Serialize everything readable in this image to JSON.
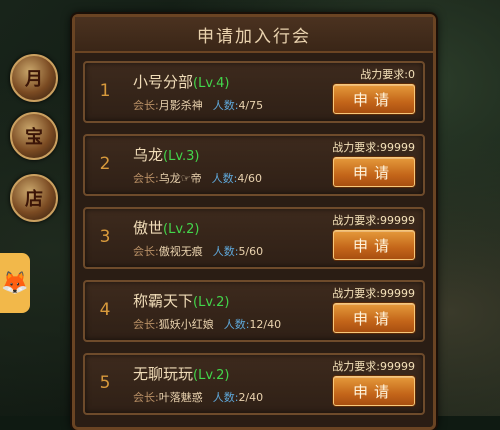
{
  "dialog": {
    "title": "申请加入行会",
    "leader_label": "会长:",
    "count_label": "人数:",
    "req_label": "战力要求:",
    "apply_label": "申请",
    "guilds": [
      {
        "rank": "1",
        "name": "小号分部",
        "level": "(Lv.4)",
        "leader": "月影杀神",
        "count": "4/75",
        "req": "0"
      },
      {
        "rank": "2",
        "name": "乌龙",
        "level": "(Lv.3)",
        "leader": "乌龙☞帝",
        "count": "4/60",
        "req": "99999"
      },
      {
        "rank": "3",
        "name": "傲世",
        "level": "(Lv.2)",
        "leader": "傲视无痕",
        "count": "5/60",
        "req": "99999"
      },
      {
        "rank": "4",
        "name": "称霸天下",
        "level": "(Lv.2)",
        "leader": "狐妖小红娘",
        "count": "12/40",
        "req": "99999"
      },
      {
        "rank": "5",
        "name": "无聊玩玩",
        "level": "(Lv.2)",
        "leader": "叶落魅惑",
        "count": "2/40",
        "req": "99999"
      }
    ]
  },
  "side": {
    "buttons": [
      {
        "icon": "calendar-icon",
        "glyph": "月"
      },
      {
        "icon": "treasure-bowl-icon",
        "glyph": "宝"
      },
      {
        "icon": "shop-icon",
        "glyph": "店"
      }
    ],
    "fox_icon": "fox-avatar-icon"
  },
  "colors": {
    "accent": "#d07a24",
    "level_green": "#43d64b",
    "count_blue": "#5fa7d8",
    "frame": "#6a4423"
  }
}
